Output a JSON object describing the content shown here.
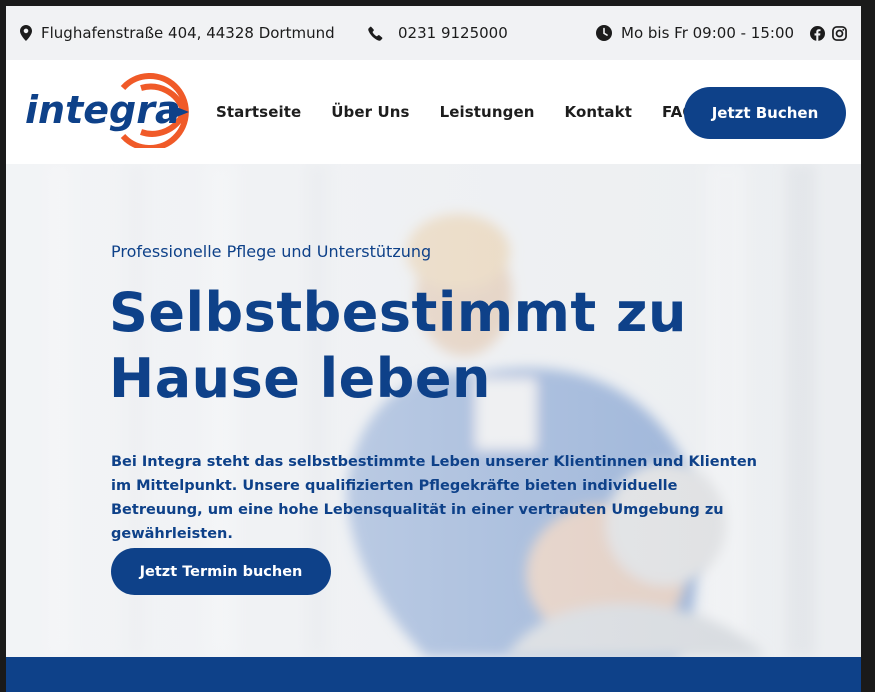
{
  "topbar": {
    "address": "Flughafenstraße 404, 44328 Dortmund",
    "phone": "0231 9125000",
    "hours": "Mo bis Fr 09:00 - 15:00",
    "icons": [
      "map-pin-icon",
      "phone-icon",
      "clock-icon",
      "facebook-icon",
      "instagram-icon"
    ]
  },
  "header": {
    "logo_text": "integra",
    "nav": [
      "Startseite",
      "Über Uns",
      "Leistungen",
      "Kontakt",
      "FAQ"
    ],
    "cta": "Jetzt Buchen"
  },
  "hero": {
    "eyebrow": "Professionelle Pflege und Unterstützung",
    "headline_line1": "Selbstbestimmt zu",
    "headline_line2": "Hause leben",
    "intro": "Bei Integra steht das selbstbestimmte Leben unserer Klientinnen und Klienten im Mittelpunkt. Unsere qualifizierten Pflegekräfte bieten individuelle Betreuung, um eine hohe Lebensqualität in einer vertrauten Umgebung zu gewährleisten.",
    "cta": "Jetzt Termin buchen"
  },
  "colors": {
    "brand_blue": "#0e4189",
    "logo_orange": "#f05a28",
    "topbar_bg": "#f1f2f4"
  }
}
